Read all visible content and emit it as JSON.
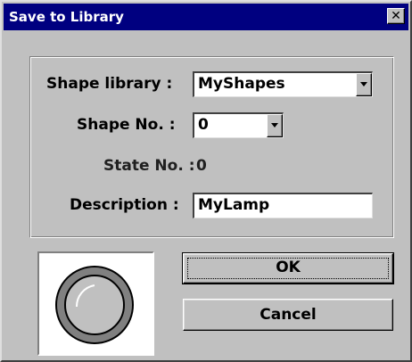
{
  "dialog": {
    "title": "Save to Library",
    "close_glyph": "✕"
  },
  "form": {
    "shape_library_label": "Shape library :",
    "shape_library_value": "MyShapes",
    "shape_no_label": "Shape No. :",
    "shape_no_value": "0",
    "state_no_label": "State No. :",
    "state_no_value": "0",
    "description_label": "Description :",
    "description_value": "MyLamp"
  },
  "buttons": {
    "ok_label": "OK",
    "cancel_label": "Cancel"
  },
  "preview": {
    "shape": "lamp-icon",
    "colors": {
      "ring_outer": "#000000",
      "ring_fill": "#808080",
      "inner_fill": "#c0c0c0",
      "highlight": "#ffffff"
    }
  },
  "colors": {
    "titlebar": "#000080",
    "face": "#c0c0c0"
  }
}
